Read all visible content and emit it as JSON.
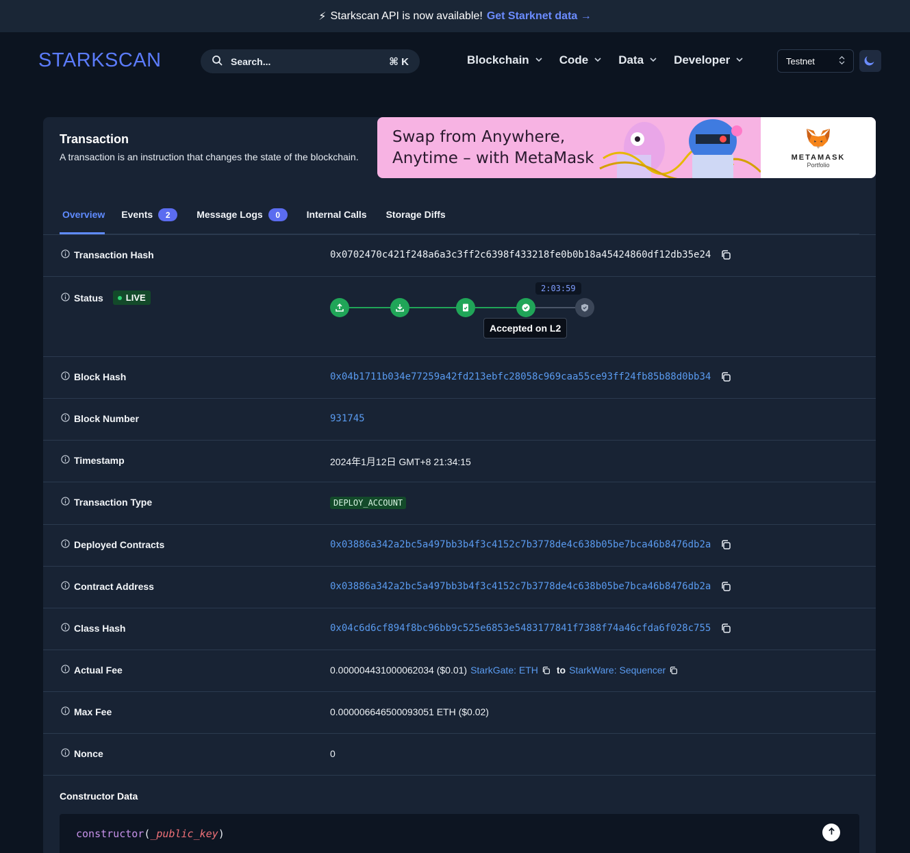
{
  "announcement": {
    "icon": "lightning-icon",
    "text": "Starkscan API is now available!",
    "link": "Get Starknet data →"
  },
  "header": {
    "logo": "STARKSCAN",
    "search_placeholder": "Search...",
    "search_shortcut": "⌘ K",
    "nav": [
      {
        "label": "Blockchain"
      },
      {
        "label": "Code"
      },
      {
        "label": "Data"
      },
      {
        "label": "Developer"
      }
    ],
    "network": "Testnet"
  },
  "page": {
    "title": "Transaction",
    "subtitle": "A transaction is an instruction that changes the state of the blockchain."
  },
  "ad": {
    "line1": "Swap from Anywhere,",
    "line2": "Anytime – with MetaMask",
    "brand": "METAMASK",
    "brand_sub": "Portfolio"
  },
  "tabs": [
    {
      "label": "Overview",
      "active": true
    },
    {
      "label": "Events",
      "badge": "2"
    },
    {
      "label": "Message Logs",
      "badge": "0"
    },
    {
      "label": "Internal Calls"
    },
    {
      "label": "Storage Diffs"
    }
  ],
  "details": {
    "tx_hash": {
      "label": "Transaction Hash",
      "value": "0x0702470c421f248a6a3c3ff2c6398f433218fe0b0b18a45424860df12db35e24"
    },
    "status": {
      "label": "Status",
      "badge": "LIVE",
      "timer": "2:03:59",
      "tooltip": "Accepted on L2"
    },
    "block_hash": {
      "label": "Block Hash",
      "value": "0x04b1711b034e77259a42fd213ebfc28058c969caa55ce93ff24fb85b88d0bb34"
    },
    "block_number": {
      "label": "Block Number",
      "value": "931745"
    },
    "timestamp": {
      "label": "Timestamp",
      "value": "2024年1月12日 GMT+8 21:34:15"
    },
    "tx_type": {
      "label": "Transaction Type",
      "value": "DEPLOY_ACCOUNT"
    },
    "deployed": {
      "label": "Deployed Contracts",
      "value": "0x03886a342a2bc5a497bb3b4f3c4152c7b3778de4c638b05be7bca46b8476db2a"
    },
    "contract_address": {
      "label": "Contract Address",
      "value": "0x03886a342a2bc5a497bb3b4f3c4152c7b3778de4c638b05be7bca46b8476db2a"
    },
    "class_hash": {
      "label": "Class Hash",
      "value": "0x04c6d6cf894f8bc96bb9c525e6853e5483177841f7388f74a46cfda6f028c755"
    },
    "actual_fee": {
      "label": "Actual Fee",
      "value": "0.000004431000062034 ($0.01)",
      "from": "StarkGate: ETH",
      "to_word": "to",
      "to": "StarkWare: Sequencer"
    },
    "max_fee": {
      "label": "Max Fee",
      "value": "0.000006646500093051 ETH ($0.02)"
    },
    "nonce": {
      "label": "Nonce",
      "value": "0"
    }
  },
  "constructor": {
    "title": "Constructor Data",
    "fn": "constructor",
    "arg": "_public_key"
  },
  "colors": {
    "accent": "#5b7bfa",
    "link": "#5a9bf0",
    "success": "#20a558",
    "background": "#0c1420",
    "card": "#182334"
  }
}
